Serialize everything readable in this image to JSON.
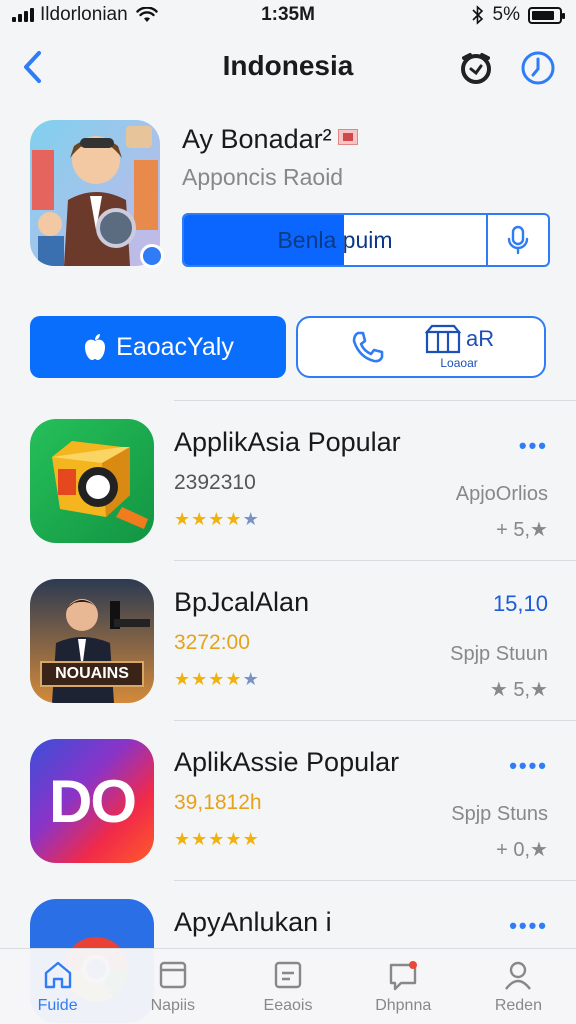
{
  "status_bar": {
    "carrier": "Ildorlonian",
    "time": "1:35M",
    "battery": "5%",
    "battery_level": 0.85
  },
  "nav": {
    "title": "Indonesia",
    "icons": [
      "back-chevron-icon",
      "refresh-icon",
      "clock-icon"
    ]
  },
  "featured": {
    "title": "Ay Bonadar²",
    "subtitle": "Apponcis Raoid",
    "action_label": "Benla puim",
    "verified": true
  },
  "buttons": {
    "primary_label": "EaoacYaly",
    "secondary_top": "aR",
    "secondary_bottom": "Loaoar"
  },
  "apps": [
    {
      "title": "ApplikAsia Popular",
      "count": "2392310",
      "count_color": "gray",
      "stars": 4,
      "more": "•••",
      "category": "ApjoOrlios",
      "rating": "+ 5,★"
    },
    {
      "title": "BpJcalAlan",
      "count": "3272:00",
      "count_color": "orange",
      "stars": 4,
      "more": "15,10",
      "category": "Spjp Stuun",
      "rating": "★ 5,★",
      "icon_text": "NOUAINS"
    },
    {
      "title": "AplikAssie Popular",
      "count": "39,1812h",
      "count_color": "orange",
      "stars": 5,
      "more": "••••",
      "category": "Spjp Stuns",
      "rating": "+ 0,★",
      "icon_text": "DO"
    },
    {
      "title": "ApyAnlukan i",
      "more": "••••"
    }
  ],
  "tabs": [
    {
      "label": "Fuide",
      "icon": "home-icon",
      "active": true
    },
    {
      "label": "Napiis",
      "icon": "apps-icon",
      "active": false
    },
    {
      "label": "Eeaois",
      "icon": "games-icon",
      "active": false
    },
    {
      "label": "Dhpnna",
      "icon": "updates-icon",
      "active": false
    },
    {
      "label": "Reden",
      "icon": "profile-icon",
      "active": false
    }
  ],
  "colors": {
    "accent": "#0a6efd",
    "accent_light": "#2f7cf6",
    "star": "#f2b20c",
    "orange_text": "#e6a21a"
  }
}
